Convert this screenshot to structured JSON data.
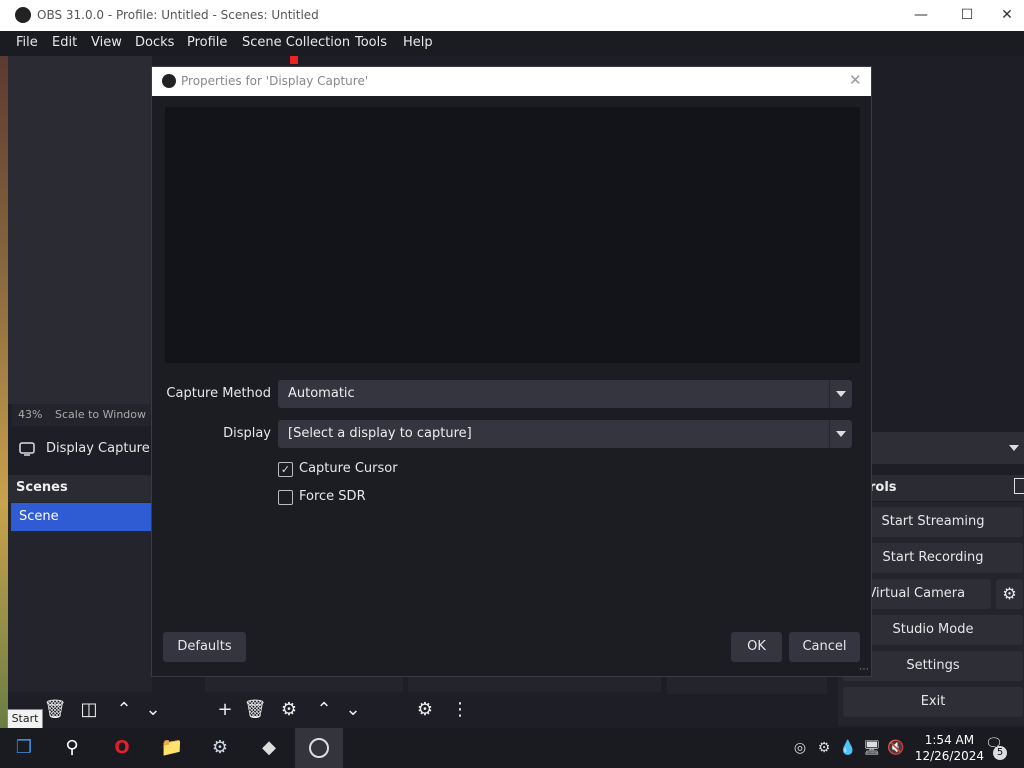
{
  "window": {
    "title": "OBS 31.0.0 - Profile: Untitled - Scenes: Untitled"
  },
  "menu": [
    "File",
    "Edit",
    "View",
    "Docks",
    "Profile",
    "Scene Collection",
    "Tools",
    "Help"
  ],
  "status": {
    "zoom": "43%",
    "scale": "Scale to Window"
  },
  "source": {
    "name": "Display Capture"
  },
  "scenes": {
    "header": "Scenes",
    "items": [
      "Scene"
    ]
  },
  "controls": {
    "header": "rols",
    "start_streaming": "Start Streaming",
    "start_recording": "Start Recording",
    "virtual_camera": "art Virtual Camera",
    "studio_mode": "Studio Mode",
    "settings": "Settings",
    "exit": "Exit"
  },
  "dialog": {
    "title": "Properties for 'Display Capture'",
    "capture_method_label": "Capture Method",
    "capture_method_value": "Automatic",
    "display_label": "Display",
    "display_value": "[Select a display to capture]",
    "capture_cursor_label": "Capture Cursor",
    "capture_cursor_checked": true,
    "force_sdr_label": "Force SDR",
    "force_sdr_checked": false,
    "defaults": "Defaults",
    "ok": "OK",
    "cancel": "Cancel"
  },
  "tooltip": "Start",
  "clock": {
    "time": "1:54 AM",
    "date": "12/26/2024"
  },
  "notifications": "5",
  "colors": {
    "accent": "#2f5bd3",
    "bg": "#1e1f26",
    "dialog_bg": "#1c1d23"
  }
}
